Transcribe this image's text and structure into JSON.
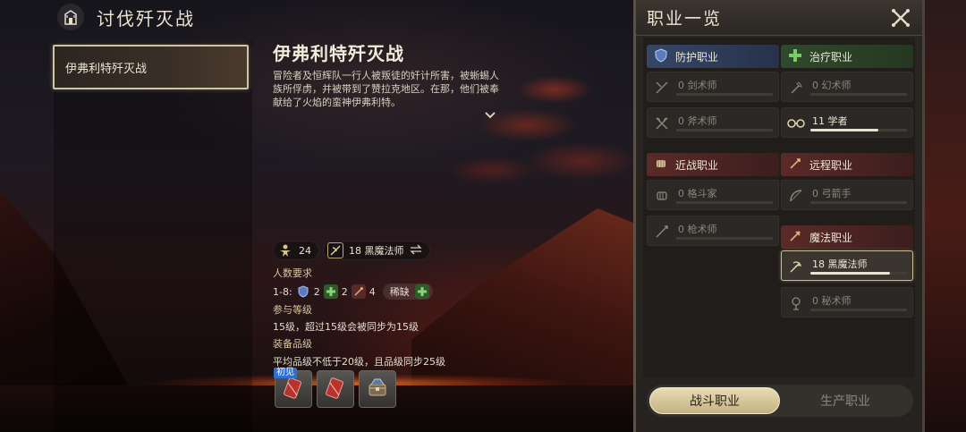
{
  "header": {
    "title": "讨伐歼灭战",
    "icon": "castle-icon"
  },
  "duty_list": [
    {
      "label": "伊弗利特歼灭战"
    }
  ],
  "duty": {
    "title": "伊弗利特歼灭战",
    "description": "冒险者及恒辉队一行人被叛徒的奸计所害，被蜥蜴人族所俘虏，并被带到了赞拉克地区。在那，他们被奉献给了火焰的蛮神伊弗利特。",
    "item_level_chip": "24",
    "job_chip": "18 黑魔法师",
    "party_label": "人数要求",
    "party_range": "1-8:",
    "party_tank": "2",
    "party_healer": "2",
    "party_dps": "4",
    "lack_label": "稀缺",
    "level_label": "参与等级",
    "level_text": "15级，超过15级会被同步为15级",
    "gear_label": "装备品级",
    "gear_text": "平均品级不低于20级，且品级同步25级",
    "new_badge": "初见"
  },
  "job_panel": {
    "title": "职业一览",
    "categories": {
      "tank": "防护职业",
      "healer": "治疗职业",
      "melee": "近战职业",
      "ranged": "远程职业",
      "magic": "魔法职业"
    },
    "jobs": {
      "gladiator": {
        "text": "0 剑术师",
        "progress": 0
      },
      "marauder": {
        "text": "0 斧术师",
        "progress": 0
      },
      "conjurer": {
        "text": "0 幻术师",
        "progress": 0
      },
      "scholar": {
        "text": "11 学者",
        "progress": 0.7
      },
      "pugilist": {
        "text": "0 格斗家",
        "progress": 0
      },
      "lancer": {
        "text": "0 枪术师",
        "progress": 0
      },
      "archer": {
        "text": "0 弓箭手",
        "progress": 0
      },
      "blackmage": {
        "text": "18 黑魔法师",
        "progress": 0.82
      },
      "arcanist": {
        "text": "0 秘术师",
        "progress": 0
      }
    },
    "tabs": {
      "combat": "战斗职业",
      "crafting": "生产职业"
    }
  },
  "colors": {
    "accent": "#cfc5a4",
    "tank": "#354767",
    "healer": "#2f4a2b",
    "dps": "#5a2a28"
  }
}
